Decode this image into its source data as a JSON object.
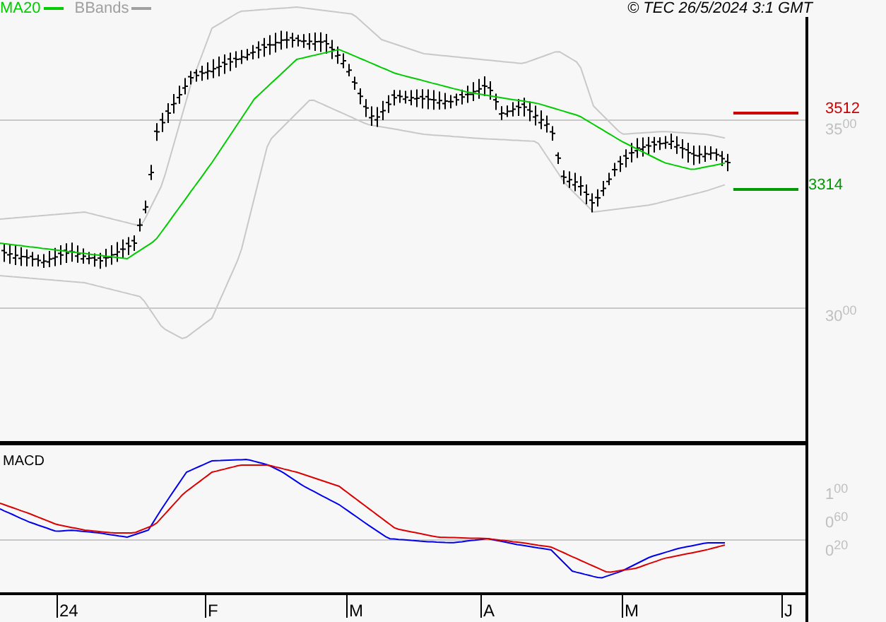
{
  "legend": [
    {
      "label": "MA20",
      "color": "#00cc00"
    },
    {
      "label": "BBands",
      "color": "#a0a0a0"
    }
  ],
  "copyright": "© TEC 26/5/2024 3:1 GMT",
  "price_axis": [
    {
      "label": "35$^{00}$",
      "kind": "major"
    },
    {
      "label": "30$^{00}$",
      "kind": "major"
    }
  ],
  "levels": [
    {
      "label": "3512",
      "color": "#cc0000"
    },
    {
      "label": "3314",
      "color": "#009900"
    }
  ],
  "macd": {
    "title": "MACD",
    "axis": [
      "1$^{00}$",
      "0$^{60}$",
      "0$^{20}$"
    ]
  },
  "months": [
    "24",
    "F",
    "M",
    "A",
    "M",
    "J"
  ]
}
